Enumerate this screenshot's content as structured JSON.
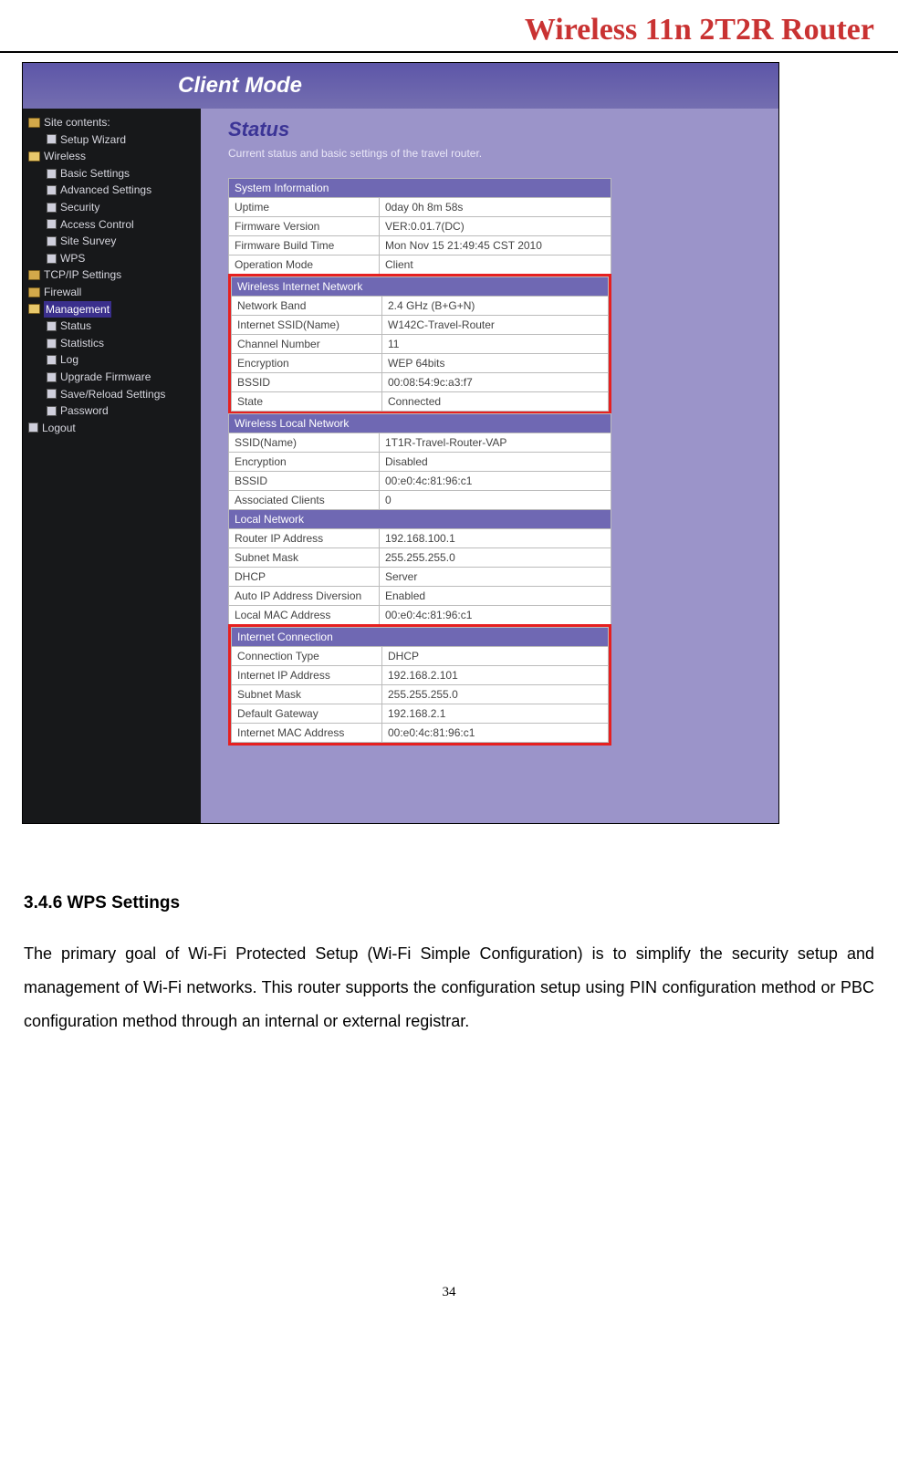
{
  "header": {
    "brand": "Wireless 11n 2T2R Router"
  },
  "screenshot": {
    "titlebar": "Client Mode",
    "sidebar": {
      "siteContents": "Site contents:",
      "setupWizard": "Setup Wizard",
      "wireless": "Wireless",
      "wirelessChildren": [
        "Basic Settings",
        "Advanced Settings",
        "Security",
        "Access Control",
        "Site Survey",
        "WPS"
      ],
      "tcpip": "TCP/IP Settings",
      "firewall": "Firewall",
      "management": "Management",
      "managementChildren": [
        "Status",
        "Statistics",
        "Log",
        "Upgrade Firmware",
        "Save/Reload Settings",
        "Password"
      ],
      "logout": "Logout"
    },
    "content": {
      "title": "Status",
      "subtitle": "Current status and basic settings of the travel router.",
      "sections": {
        "sysInfo": {
          "header": "System Information",
          "rows": [
            {
              "label": "Uptime",
              "value": "0day 0h 8m 58s"
            },
            {
              "label": "Firmware Version",
              "value": "VER:0.01.7(DC)"
            },
            {
              "label": "Firmware Build Time",
              "value": "Mon Nov 15 21:49:45 CST 2010"
            },
            {
              "label": "Operation Mode",
              "value": "Client"
            }
          ]
        },
        "wirelessInternet": {
          "header": "Wireless Internet Network",
          "rows": [
            {
              "label": "Network Band",
              "value": "2.4 GHz (B+G+N)"
            },
            {
              "label": "Internet SSID(Name)",
              "value": "W142C-Travel-Router"
            },
            {
              "label": "Channel Number",
              "value": "11"
            },
            {
              "label": "Encryption",
              "value": "WEP 64bits"
            },
            {
              "label": "BSSID",
              "value": "00:08:54:9c:a3:f7"
            },
            {
              "label": "State",
              "value": "Connected"
            }
          ]
        },
        "wirelessLocal": {
          "header": "Wireless Local Network",
          "rows": [
            {
              "label": "SSID(Name)",
              "value": "1T1R-Travel-Router-VAP"
            },
            {
              "label": "Encryption",
              "value": "Disabled"
            },
            {
              "label": "BSSID",
              "value": "00:e0:4c:81:96:c1"
            },
            {
              "label": "Associated Clients",
              "value": "0"
            }
          ]
        },
        "localNet": {
          "header": "Local Network",
          "rows": [
            {
              "label": "Router IP Address",
              "value": "192.168.100.1"
            },
            {
              "label": "Subnet Mask",
              "value": "255.255.255.0"
            },
            {
              "label": "DHCP",
              "value": "Server"
            },
            {
              "label": "Auto IP Address Diversion",
              "value": "Enabled"
            },
            {
              "label": "Local MAC Address",
              "value": "00:e0:4c:81:96:c1"
            }
          ]
        },
        "internetConn": {
          "header": "Internet Connection",
          "rows": [
            {
              "label": "Connection Type",
              "value": "DHCP"
            },
            {
              "label": "Internet IP Address",
              "value": "192.168.2.101"
            },
            {
              "label": "Subnet Mask",
              "value": "255.255.255.0"
            },
            {
              "label": "Default Gateway",
              "value": "192.168.2.1"
            },
            {
              "label": "Internet MAC Address",
              "value": "00:e0:4c:81:96:c1"
            }
          ]
        }
      }
    }
  },
  "body": {
    "heading": "3.4.6 WPS Settings",
    "paragraph": "The primary goal of Wi-Fi Protected Setup (Wi-Fi Simple Configuration) is to simplify the security setup and management of Wi-Fi networks. This router supports the configuration setup using PIN configuration method or PBC configuration method through an internal or external registrar."
  },
  "footer": {
    "page": "34"
  }
}
